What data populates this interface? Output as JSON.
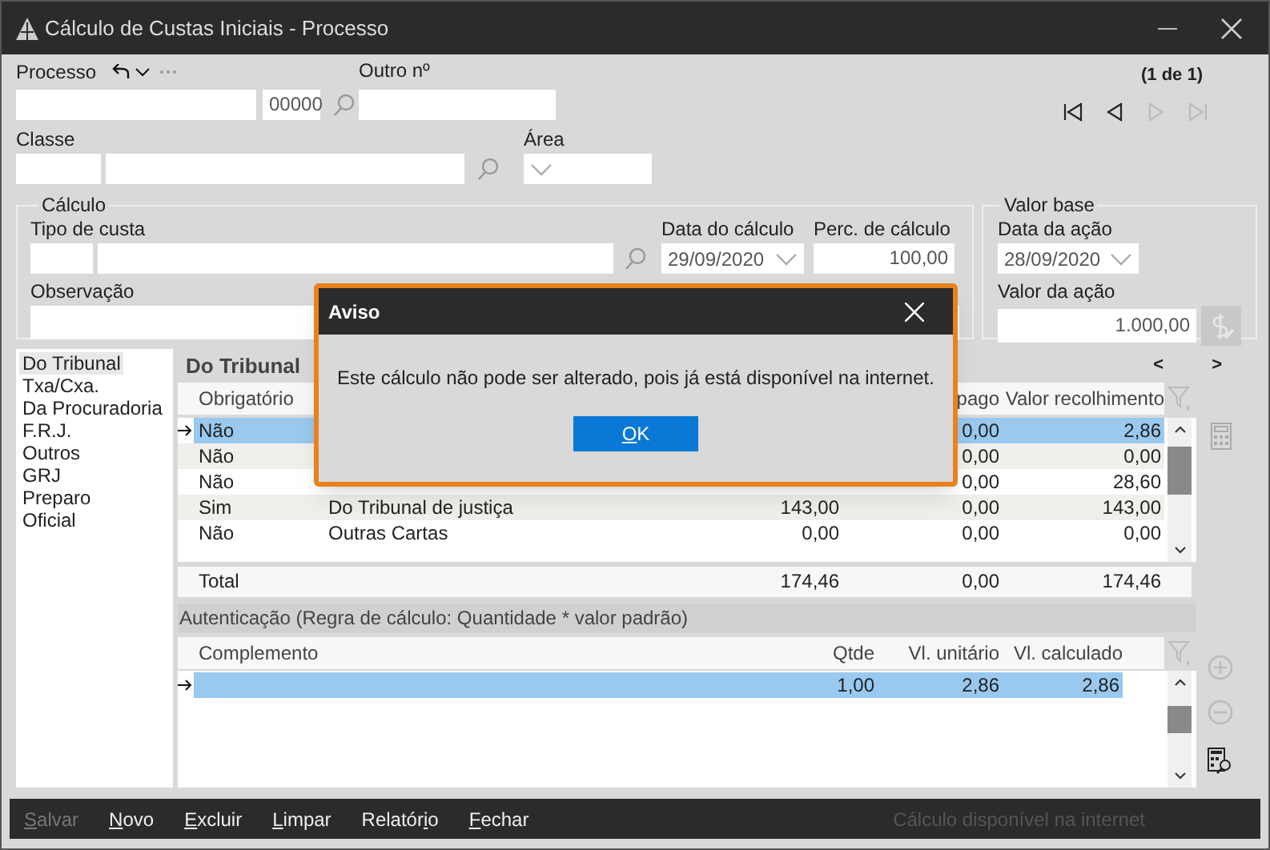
{
  "window": {
    "title": "Cálculo de Custas Iniciais - Processo"
  },
  "header": {
    "processo_label": "Processo",
    "processo_number": "00000",
    "outro_label": "Outro nº",
    "pager": "(1 de 1)",
    "classe_label": "Classe",
    "area_label": "Área",
    "nav": [
      {
        "kind": "first",
        "disabled": false
      },
      {
        "kind": "prev",
        "disabled": false
      },
      {
        "kind": "next",
        "disabled": true
      },
      {
        "kind": "last",
        "disabled": true
      }
    ]
  },
  "calculo": {
    "legend": "Cálculo",
    "tipo_label": "Tipo de custa",
    "data_label": "Data do cálculo",
    "data_value": "29/09/2020",
    "perc_label": "Perc. de cálculo",
    "perc_value": "100,00",
    "obs_label": "Observação"
  },
  "valor_base": {
    "legend": "Valor base",
    "data_label": "Data da ação",
    "data_value": "28/09/2020",
    "valor_label": "Valor da ação",
    "valor_value": "1.000,00"
  },
  "categories": [
    {
      "label": "Do Tribunal",
      "selected": true
    },
    {
      "label": "Txa/Cxa.",
      "selected": false
    },
    {
      "label": "Da Procuradoria",
      "selected": false
    },
    {
      "label": "F.R.J.",
      "selected": false
    },
    {
      "label": "Outros",
      "selected": false
    },
    {
      "label": "GRJ",
      "selected": false
    },
    {
      "label": "Preparo",
      "selected": false
    },
    {
      "label": "Oficial",
      "selected": false
    }
  ],
  "costs": {
    "title": "Do Tribunal",
    "prev": "<",
    "next": ">",
    "columns": [
      "Obrigatório",
      "pago",
      "Valor recolhimento"
    ],
    "rows": [
      {
        "selected": true,
        "obrigatorio": "Não",
        "pago": "0,00",
        "recolhimento": "2,86"
      },
      {
        "selected": false,
        "obrigatorio": "Não",
        "pago": "0,00",
        "recolhimento": "0,00"
      },
      {
        "selected": false,
        "obrigatorio": "Não",
        "pago": "0,00",
        "recolhimento": "28,60"
      },
      {
        "selected": false,
        "obrigatorio": "Sim",
        "descricao": "Do Tribunal de justiça",
        "valor": "143,00",
        "pago": "0,00",
        "recolhimento": "143,00"
      },
      {
        "selected": false,
        "obrigatorio": "Não",
        "descricao": "Outras Cartas",
        "valor": "0,00",
        "pago": "0,00",
        "recolhimento": "0,00"
      }
    ],
    "total": {
      "label": "Total",
      "valor": "174,46",
      "pago": "0,00",
      "recolhimento": "174,46"
    }
  },
  "auth": {
    "title": "Autenticação (Regra de cálculo: Quantidade * valor padrão)",
    "columns": [
      "Complemento",
      "Qtde",
      "Vl. unitário",
      "Vl. calculado"
    ],
    "rows": [
      {
        "selected": true,
        "qtde": "1,00",
        "unitario": "2,86",
        "calculado": "2,86"
      }
    ]
  },
  "toolbar": [
    {
      "key": "S",
      "after": "alvar",
      "disabled": true
    },
    {
      "key": "N",
      "after": "ovo",
      "disabled": false
    },
    {
      "key": "E",
      "after": "xcluir",
      "disabled": false
    },
    {
      "key": "L",
      "after": "impar",
      "disabled": false
    },
    {
      "before": "Relatór",
      "key": "i",
      "after": "o",
      "disabled": false
    },
    {
      "key": "F",
      "after": "echar",
      "disabled": false
    }
  ],
  "status": "Cálculo disponível na internet",
  "dialog": {
    "title": "Aviso",
    "message": "Este cálculo não pode ser alterado, pois já está disponível na internet.",
    "button": {
      "key": "O",
      "after": "K"
    }
  }
}
